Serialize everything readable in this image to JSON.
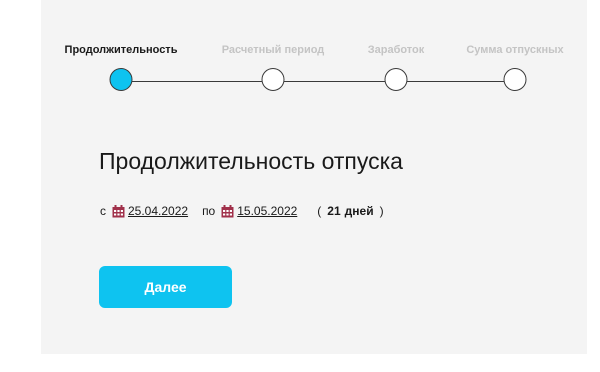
{
  "steps": [
    {
      "label": "Продолжительность",
      "active": true
    },
    {
      "label": "Расчетный период",
      "active": false
    },
    {
      "label": "Заработок",
      "active": false
    },
    {
      "label": "Сумма отпускных",
      "active": false
    }
  ],
  "main": {
    "title": "Продолжительность отпуска",
    "from_label": "с",
    "from_date": "25.04.2022",
    "to_label": "по",
    "to_date": "15.05.2022",
    "open_paren": "(",
    "days_count": "21",
    "days_word": "дней",
    "close_paren": ")",
    "next_button": "Далее"
  },
  "colors": {
    "accent": "#0ec3f0",
    "calendar_icon": "#a0304a",
    "panel_bg": "#f4f4f4"
  }
}
